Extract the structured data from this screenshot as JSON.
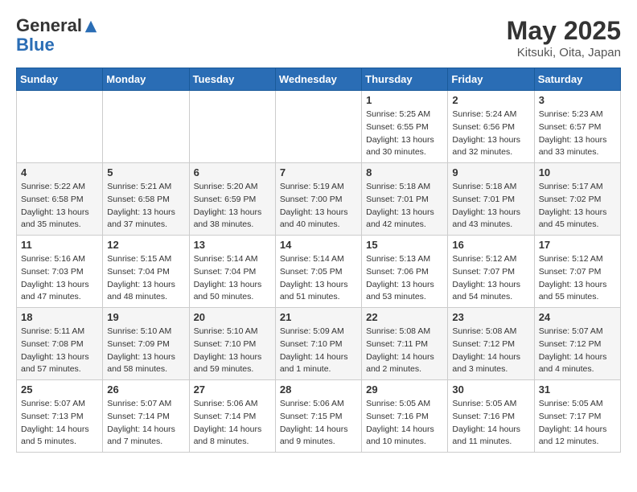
{
  "header": {
    "logo_general": "General",
    "logo_blue": "Blue",
    "month_title": "May 2025",
    "location": "Kitsuki, Oita, Japan"
  },
  "weekdays": [
    "Sunday",
    "Monday",
    "Tuesday",
    "Wednesday",
    "Thursday",
    "Friday",
    "Saturday"
  ],
  "weeks": [
    [
      {
        "day": "",
        "info": ""
      },
      {
        "day": "",
        "info": ""
      },
      {
        "day": "",
        "info": ""
      },
      {
        "day": "",
        "info": ""
      },
      {
        "day": "1",
        "info": "Sunrise: 5:25 AM\nSunset: 6:55 PM\nDaylight: 13 hours\nand 30 minutes."
      },
      {
        "day": "2",
        "info": "Sunrise: 5:24 AM\nSunset: 6:56 PM\nDaylight: 13 hours\nand 32 minutes."
      },
      {
        "day": "3",
        "info": "Sunrise: 5:23 AM\nSunset: 6:57 PM\nDaylight: 13 hours\nand 33 minutes."
      }
    ],
    [
      {
        "day": "4",
        "info": "Sunrise: 5:22 AM\nSunset: 6:58 PM\nDaylight: 13 hours\nand 35 minutes."
      },
      {
        "day": "5",
        "info": "Sunrise: 5:21 AM\nSunset: 6:58 PM\nDaylight: 13 hours\nand 37 minutes."
      },
      {
        "day": "6",
        "info": "Sunrise: 5:20 AM\nSunset: 6:59 PM\nDaylight: 13 hours\nand 38 minutes."
      },
      {
        "day": "7",
        "info": "Sunrise: 5:19 AM\nSunset: 7:00 PM\nDaylight: 13 hours\nand 40 minutes."
      },
      {
        "day": "8",
        "info": "Sunrise: 5:18 AM\nSunset: 7:01 PM\nDaylight: 13 hours\nand 42 minutes."
      },
      {
        "day": "9",
        "info": "Sunrise: 5:18 AM\nSunset: 7:01 PM\nDaylight: 13 hours\nand 43 minutes."
      },
      {
        "day": "10",
        "info": "Sunrise: 5:17 AM\nSunset: 7:02 PM\nDaylight: 13 hours\nand 45 minutes."
      }
    ],
    [
      {
        "day": "11",
        "info": "Sunrise: 5:16 AM\nSunset: 7:03 PM\nDaylight: 13 hours\nand 47 minutes."
      },
      {
        "day": "12",
        "info": "Sunrise: 5:15 AM\nSunset: 7:04 PM\nDaylight: 13 hours\nand 48 minutes."
      },
      {
        "day": "13",
        "info": "Sunrise: 5:14 AM\nSunset: 7:04 PM\nDaylight: 13 hours\nand 50 minutes."
      },
      {
        "day": "14",
        "info": "Sunrise: 5:14 AM\nSunset: 7:05 PM\nDaylight: 13 hours\nand 51 minutes."
      },
      {
        "day": "15",
        "info": "Sunrise: 5:13 AM\nSunset: 7:06 PM\nDaylight: 13 hours\nand 53 minutes."
      },
      {
        "day": "16",
        "info": "Sunrise: 5:12 AM\nSunset: 7:07 PM\nDaylight: 13 hours\nand 54 minutes."
      },
      {
        "day": "17",
        "info": "Sunrise: 5:12 AM\nSunset: 7:07 PM\nDaylight: 13 hours\nand 55 minutes."
      }
    ],
    [
      {
        "day": "18",
        "info": "Sunrise: 5:11 AM\nSunset: 7:08 PM\nDaylight: 13 hours\nand 57 minutes."
      },
      {
        "day": "19",
        "info": "Sunrise: 5:10 AM\nSunset: 7:09 PM\nDaylight: 13 hours\nand 58 minutes."
      },
      {
        "day": "20",
        "info": "Sunrise: 5:10 AM\nSunset: 7:10 PM\nDaylight: 13 hours\nand 59 minutes."
      },
      {
        "day": "21",
        "info": "Sunrise: 5:09 AM\nSunset: 7:10 PM\nDaylight: 14 hours\nand 1 minute."
      },
      {
        "day": "22",
        "info": "Sunrise: 5:08 AM\nSunset: 7:11 PM\nDaylight: 14 hours\nand 2 minutes."
      },
      {
        "day": "23",
        "info": "Sunrise: 5:08 AM\nSunset: 7:12 PM\nDaylight: 14 hours\nand 3 minutes."
      },
      {
        "day": "24",
        "info": "Sunrise: 5:07 AM\nSunset: 7:12 PM\nDaylight: 14 hours\nand 4 minutes."
      }
    ],
    [
      {
        "day": "25",
        "info": "Sunrise: 5:07 AM\nSunset: 7:13 PM\nDaylight: 14 hours\nand 5 minutes."
      },
      {
        "day": "26",
        "info": "Sunrise: 5:07 AM\nSunset: 7:14 PM\nDaylight: 14 hours\nand 7 minutes."
      },
      {
        "day": "27",
        "info": "Sunrise: 5:06 AM\nSunset: 7:14 PM\nDaylight: 14 hours\nand 8 minutes."
      },
      {
        "day": "28",
        "info": "Sunrise: 5:06 AM\nSunset: 7:15 PM\nDaylight: 14 hours\nand 9 minutes."
      },
      {
        "day": "29",
        "info": "Sunrise: 5:05 AM\nSunset: 7:16 PM\nDaylight: 14 hours\nand 10 minutes."
      },
      {
        "day": "30",
        "info": "Sunrise: 5:05 AM\nSunset: 7:16 PM\nDaylight: 14 hours\nand 11 minutes."
      },
      {
        "day": "31",
        "info": "Sunrise: 5:05 AM\nSunset: 7:17 PM\nDaylight: 14 hours\nand 12 minutes."
      }
    ]
  ]
}
